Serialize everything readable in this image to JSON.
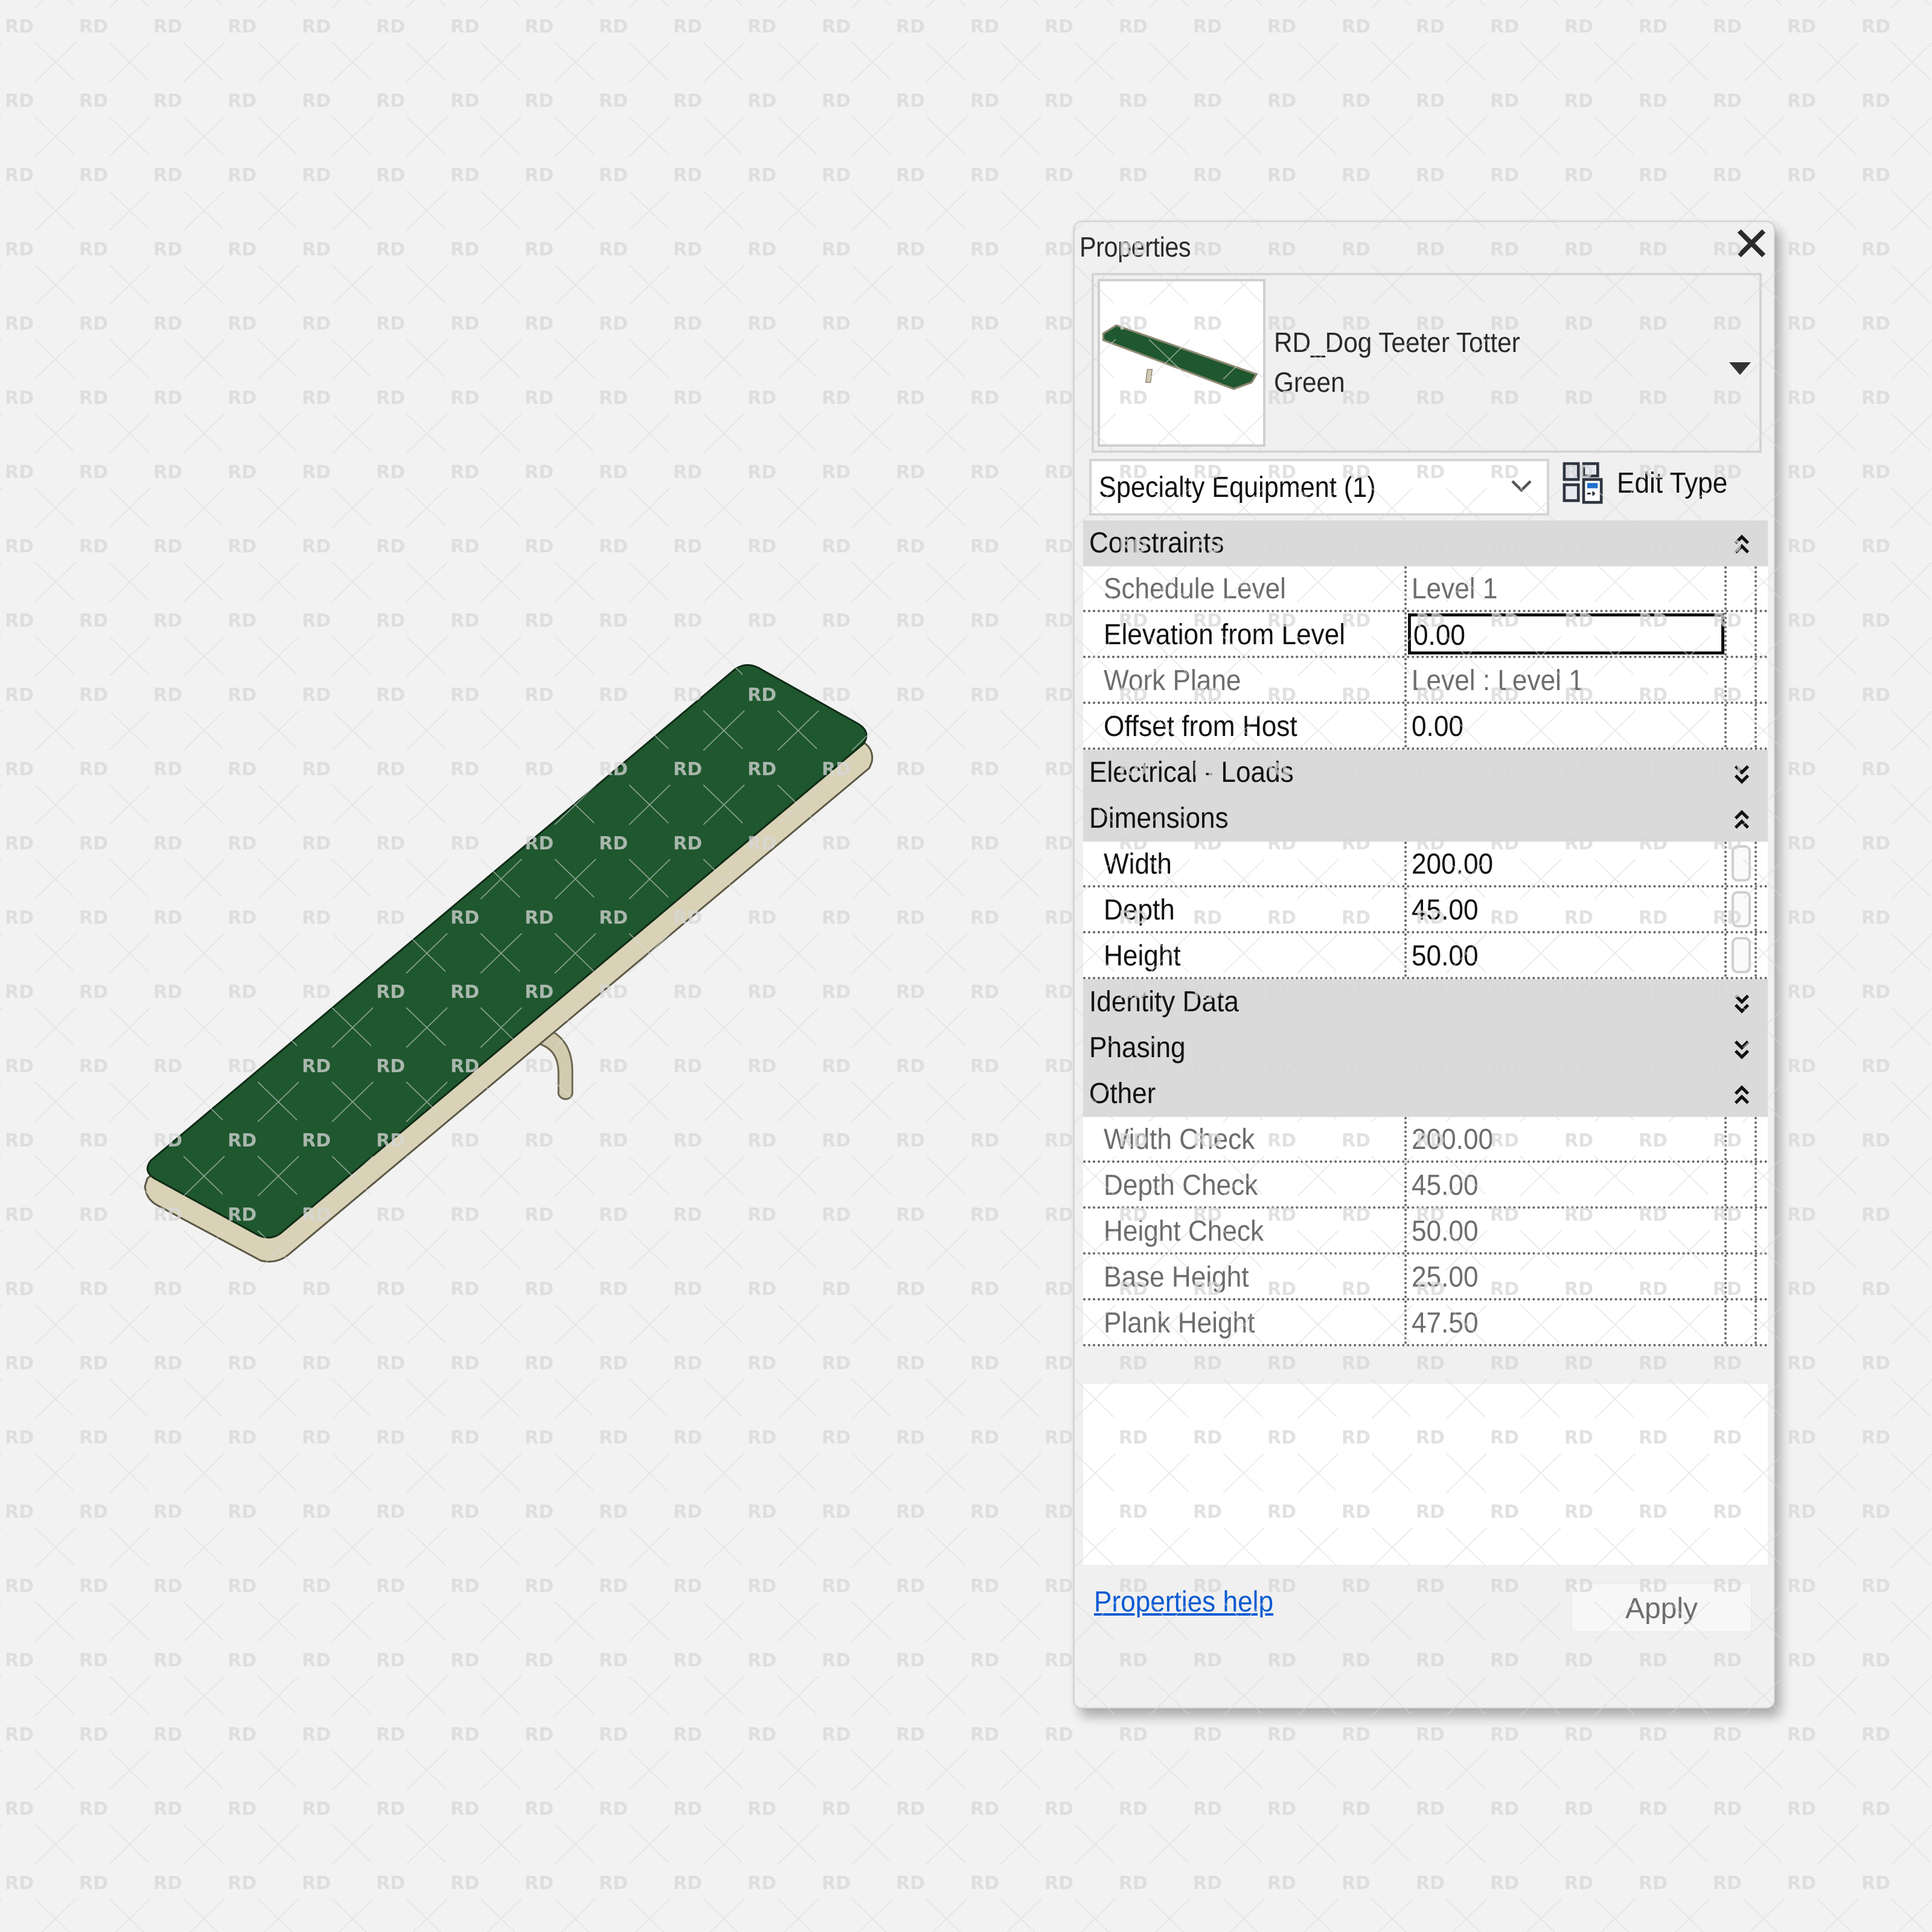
{
  "palette": {
    "title": "Properties",
    "close_icon": "close-icon"
  },
  "type_selector": {
    "family": "RD_Dog Teeter Totter",
    "type": "Green",
    "thumbnail_color": "#1f5a2d",
    "dropdown_icon": "triangle-down-icon"
  },
  "category_filter": {
    "selected": "Specialty Equipment (1)",
    "chevron_icon": "chevron-down-icon"
  },
  "edit_type": {
    "label": "Edit Type",
    "icon": "edit-type-icon"
  },
  "groups": [
    {
      "name": "Constraints",
      "expanded": true,
      "toggle": "collapse",
      "rows": [
        {
          "label": "Schedule Level",
          "value": "Level 1",
          "readonly": true
        },
        {
          "label": "Elevation from Level",
          "value": "0.00",
          "readonly": false,
          "active": true
        },
        {
          "label": "Work Plane",
          "value": "Level : Level 1",
          "readonly": true
        },
        {
          "label": "Offset from Host",
          "value": "0.00",
          "readonly": false
        }
      ]
    },
    {
      "name": "Electrical - Loads",
      "expanded": false,
      "toggle": "expand",
      "rows": []
    },
    {
      "name": "Dimensions",
      "expanded": true,
      "toggle": "collapse",
      "rows": [
        {
          "label": "Width",
          "value": "200.00",
          "readonly": false,
          "associate": true
        },
        {
          "label": "Depth",
          "value": "45.00",
          "readonly": false,
          "associate": true
        },
        {
          "label": "Height",
          "value": "50.00",
          "readonly": false,
          "associate": true
        }
      ]
    },
    {
      "name": "Identity Data",
      "expanded": false,
      "toggle": "expand",
      "rows": []
    },
    {
      "name": "Phasing",
      "expanded": false,
      "toggle": "expand",
      "rows": []
    },
    {
      "name": "Other",
      "expanded": true,
      "toggle": "collapse",
      "rows": [
        {
          "label": "Width Check",
          "value": "200.00",
          "readonly": true
        },
        {
          "label": "Depth Check",
          "value": "45.00",
          "readonly": true
        },
        {
          "label": "Height Check",
          "value": "50.00",
          "readonly": true
        },
        {
          "label": "Base Height",
          "value": "25.00",
          "readonly": true
        },
        {
          "label": "Plank Height",
          "value": "47.50",
          "readonly": true
        }
      ]
    }
  ],
  "footer": {
    "help_link": "Properties help",
    "apply_label": "Apply"
  },
  "viewport": {
    "model": "dog teeter totter",
    "plank_color": "#1f572e",
    "frame_color": "#d6cfb4"
  },
  "watermark": {
    "text": "RD",
    "color": "#dcdcdc"
  },
  "colors": {
    "background": "#f2f2f2",
    "group_header": "#dadada",
    "link": "#0a5bd3",
    "readonly_text": "#6d6d6d"
  }
}
